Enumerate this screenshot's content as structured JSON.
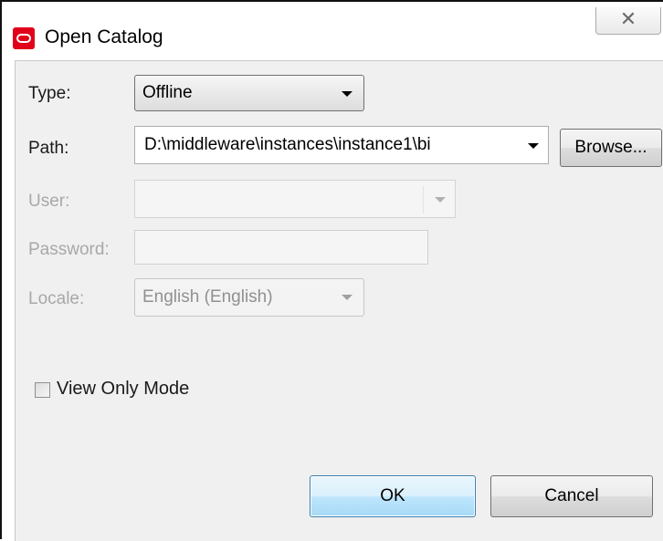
{
  "window": {
    "title": "Open Catalog",
    "icons": {
      "app": "oracle-logo-icon",
      "close": "close-icon"
    },
    "close_glyph": "☒"
  },
  "form": {
    "type": {
      "label": "Type:",
      "value": "Offline"
    },
    "path": {
      "label": "Path:",
      "value": "D:\\middleware\\instances\\instance1\\bi",
      "browse_label": "Browse..."
    },
    "user": {
      "label": "User:",
      "value": ""
    },
    "password": {
      "label": "Password:",
      "value": ""
    },
    "locale": {
      "label": "Locale:",
      "value": "English (English)"
    },
    "view_only": {
      "label": "View Only Mode",
      "checked": false
    }
  },
  "buttons": {
    "ok": "OK",
    "cancel": "Cancel"
  },
  "colors": {
    "oracle_red": "#e0001a",
    "default_button": "#bee6fd",
    "panel": "#f0f0f0"
  }
}
